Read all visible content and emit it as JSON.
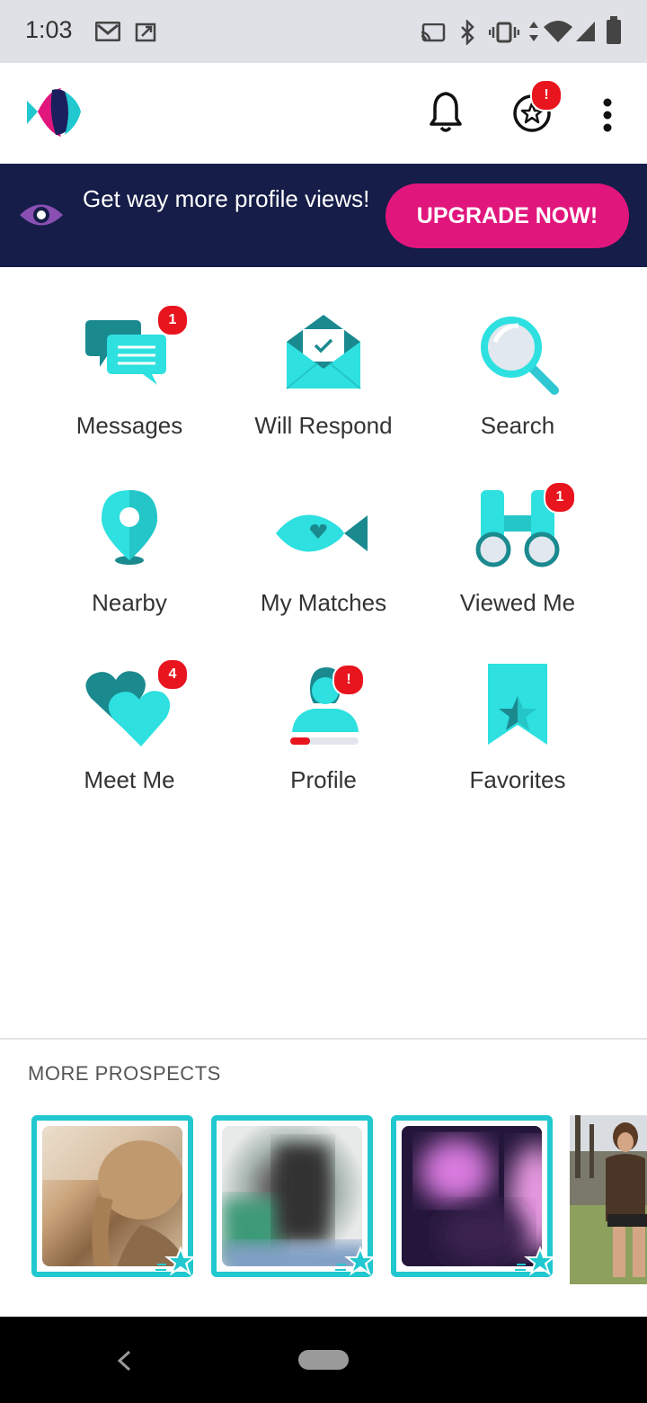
{
  "status_bar": {
    "time": "1:03"
  },
  "header": {
    "logo": "fish-logo-icon",
    "notifications_icon": "bell-icon",
    "rewards_icon": "star-badge-icon",
    "rewards_badge": "!",
    "menu_icon": "more-vert-icon"
  },
  "banner": {
    "icon": "eye-icon",
    "text": "Get way more profile views!",
    "button_label": "UPGRADE NOW!"
  },
  "grid": {
    "items": [
      {
        "label": "Messages",
        "icon": "chat-bubbles-icon",
        "badge": "1"
      },
      {
        "label": "Will Respond",
        "icon": "envelope-check-icon",
        "badge": ""
      },
      {
        "label": "Search",
        "icon": "magnifier-icon",
        "badge": ""
      },
      {
        "label": "Nearby",
        "icon": "location-pin-icon",
        "badge": ""
      },
      {
        "label": "My Matches",
        "icon": "fish-heart-icon",
        "badge": ""
      },
      {
        "label": "Viewed Me",
        "icon": "binoculars-icon",
        "badge": "1"
      },
      {
        "label": "Meet Me",
        "icon": "hearts-icon",
        "badge": "4"
      },
      {
        "label": "Profile",
        "icon": "person-progress-icon",
        "badge": "!"
      },
      {
        "label": "Favorites",
        "icon": "bookmark-star-icon",
        "badge": ""
      }
    ]
  },
  "prospects": {
    "title": "MORE PROSPECTS",
    "cards": [
      {
        "kind": "photo-braided-hair"
      },
      {
        "kind": "photo-blurred-green"
      },
      {
        "kind": "photo-blurred-purple"
      },
      {
        "kind": "photo-outdoor-woman"
      }
    ]
  },
  "colors": {
    "banner_bg": "#151d48",
    "upgrade_button": "#e1167d",
    "accent_teal": "#21c8cf",
    "badge_red": "#e8141e"
  }
}
